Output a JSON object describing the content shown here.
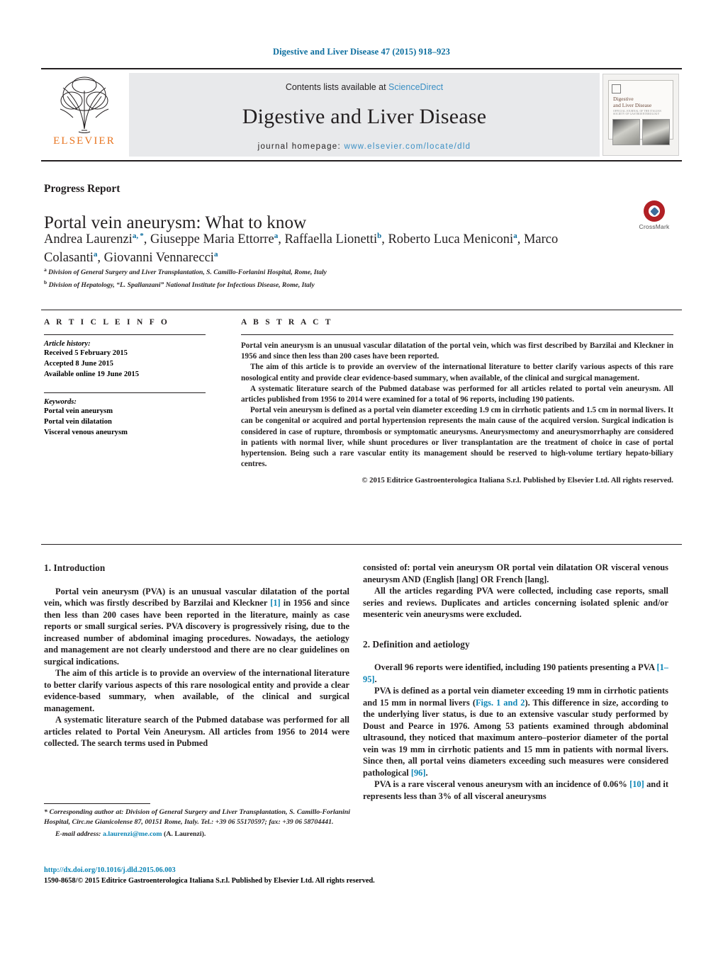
{
  "running_head": "Digestive and Liver Disease 47 (2015) 918–923",
  "masthead": {
    "contents_prefix": "Contents lists available at ",
    "sciencedirect": "ScienceDirect",
    "journal_name": "Digestive and Liver Disease",
    "homepage_label": "journal homepage:",
    "homepage_url": "www.elsevier.com/locate/dld",
    "publisher_wordmark": "ELSEVIER",
    "cover": {
      "title_line1": "Digestive",
      "title_line2": "and Liver Disease",
      "subtitle": "OFFICIAL JOURNAL OF THE ITALIAN SOCIETY OF GASTROENTEROLOGY"
    },
    "accent_orange": "#e8741f",
    "accent_blue": "#3a8fc4",
    "panel_grey": "#e8e9eb"
  },
  "article": {
    "kind": "Progress Report",
    "title": "Portal vein aneurysm: What to know",
    "authors_html": "Andrea Laurenzi<sup>a, *</sup>, Giuseppe Maria Ettorre<sup>a</sup>, Raffaella Lionetti<sup>b</sup>, Roberto Luca Meniconi<sup>a</sup>, Marco Colasanti<sup>a</sup>, Giovanni Vennarecci<sup>a</sup>",
    "affiliation_a": "Division of General Surgery and Liver Transplantation, S. Camillo-Forlanini Hospital, Rome, Italy",
    "affiliation_b": "Division of Hepatology, “L. Spallanzani” National Institute for Infectious Disease, Rome, Italy",
    "crossmark_label": "CrossMark"
  },
  "article_info": {
    "heading": "A R T I C L E    I N F O",
    "history_label": "Article history:",
    "history": [
      "Received 5 February 2015",
      "Accepted 8 June 2015",
      "Available online 19 June 2015"
    ],
    "keywords_label": "Keywords:",
    "keywords": [
      "Portal vein aneurysm",
      "Portal vein dilatation",
      "Visceral venous aneurysm"
    ]
  },
  "abstract": {
    "heading": "A B S T R A C T",
    "paragraphs": [
      "Portal vein aneurysm is an unusual vascular dilatation of the portal vein, which was first described by Barzilai and Kleckner in 1956 and since then less than 200 cases have been reported.",
      "The aim of this article is to provide an overview of the international literature to better clarify various aspects of this rare nosological entity and provide clear evidence-based summary, when available, of the clinical and surgical management.",
      "A systematic literature search of the Pubmed database was performed for all articles related to portal vein aneurysm. All articles published from 1956 to 2014 were examined for a total of 96 reports, including 190 patients.",
      "Portal vein aneurysm is defined as a portal vein diameter exceeding 1.9 cm in cirrhotic patients and 1.5 cm in normal livers. It can be congenital or acquired and portal hypertension represents the main cause of the acquired version. Surgical indication is considered in case of rupture, thrombosis or symptomatic aneurysms. Aneurysmectomy and aneurysmorrhaphy are considered in patients with normal liver, while shunt procedures or liver transplantation are the treatment of choice in case of portal hypertension. Being such a rare vascular entity its management should be reserved to high-volume tertiary hepato-biliary centres."
    ],
    "copyright": "© 2015 Editrice Gastroenterologica Italiana S.r.l. Published by Elsevier Ltd. All rights reserved."
  },
  "body": {
    "left": {
      "section_heading": "1.  Introduction",
      "paragraph_1_html": "Portal vein aneurysm (PVA) is an unusual vascular dilatation of the portal vein, which was firstly described by Barzilai and Kleckner <span class=\"ref\">[1]</span> in 1956 and since then less than 200 cases have been reported in the literature, mainly as case reports or small surgical series. PVA discovery is progressively rising, due to the increased number of abdominal imaging procedures. Nowadays, the aetiology and management are not clearly understood and there are no clear guidelines on surgical indications.",
      "paragraph_2_html": "The aim of this article is to provide an overview of the international literature to better clarify various aspects of this rare nosological entity and provide a clear evidence-based summary, when available, of the clinical and surgical management.",
      "paragraph_3_html": "A systematic literature search of the Pubmed database was performed for all articles related to Portal Vein Aneurysm. All articles from 1956 to 2014 were collected. The search terms used in Pubmed"
    },
    "right": {
      "paragraph_1_html": "consisted of: portal vein aneurysm OR portal vein dilatation OR visceral venous aneurysm AND (English [lang] OR French [lang].",
      "paragraph_2_html": "All the articles regarding PVA were collected, including case reports, small series and reviews. Duplicates and articles concerning isolated splenic and/or mesenteric vein aneurysms were excluded.",
      "section_heading": "2.  Definition and aetiology",
      "paragraph_3_html": "Overall 96 reports were identified, including 190 patients presenting a PVA <span class=\"ref\">[1–95]</span>.",
      "paragraph_4_html": "PVA is defined as a portal vein diameter exceeding 19 mm in cirrhotic patients and 15 mm in normal livers (<span class=\"ref\">Figs. 1 and 2</span>). This difference in size, according to the underlying liver status, is due to an extensive vascular study performed by Doust and Pearce in 1976. Among 53 patients examined through abdominal ultrasound, they noticed that maximum antero–posterior diameter of the portal vein was 19 mm in cirrhotic patients and 15 mm in patients with normal livers. Since then, all portal veins diameters exceeding such measures were considered pathological <span class=\"ref\">[96]</span>.",
      "paragraph_5_html": "PVA is a rare visceral venous aneurysm with an incidence of 0.06% <span class=\"ref\">[10]</span> and it represents less than 3% of all visceral aneurysms"
    }
  },
  "footnote": {
    "correspondence_html": "*  Corresponding author at: Division of General Surgery and Liver Transplantation, S. Camillo-Forlanini Hospital, Circ.ne Gianicolense 87, 00151 Rome, Italy. Tel.: +39 06 55170597; fax: +39 06 58704441.",
    "email_label": "E-mail address:",
    "email": "a.laurenzi@me.com",
    "email_owner": "(A. Laurenzi)."
  },
  "publication": {
    "doi": "http://dx.doi.org/10.1016/j.dld.2015.06.003",
    "issn_line": "1590-8658/© 2015 Editrice Gastroenterologica Italiana S.r.l. Published by Elsevier Ltd. All rights reserved."
  }
}
